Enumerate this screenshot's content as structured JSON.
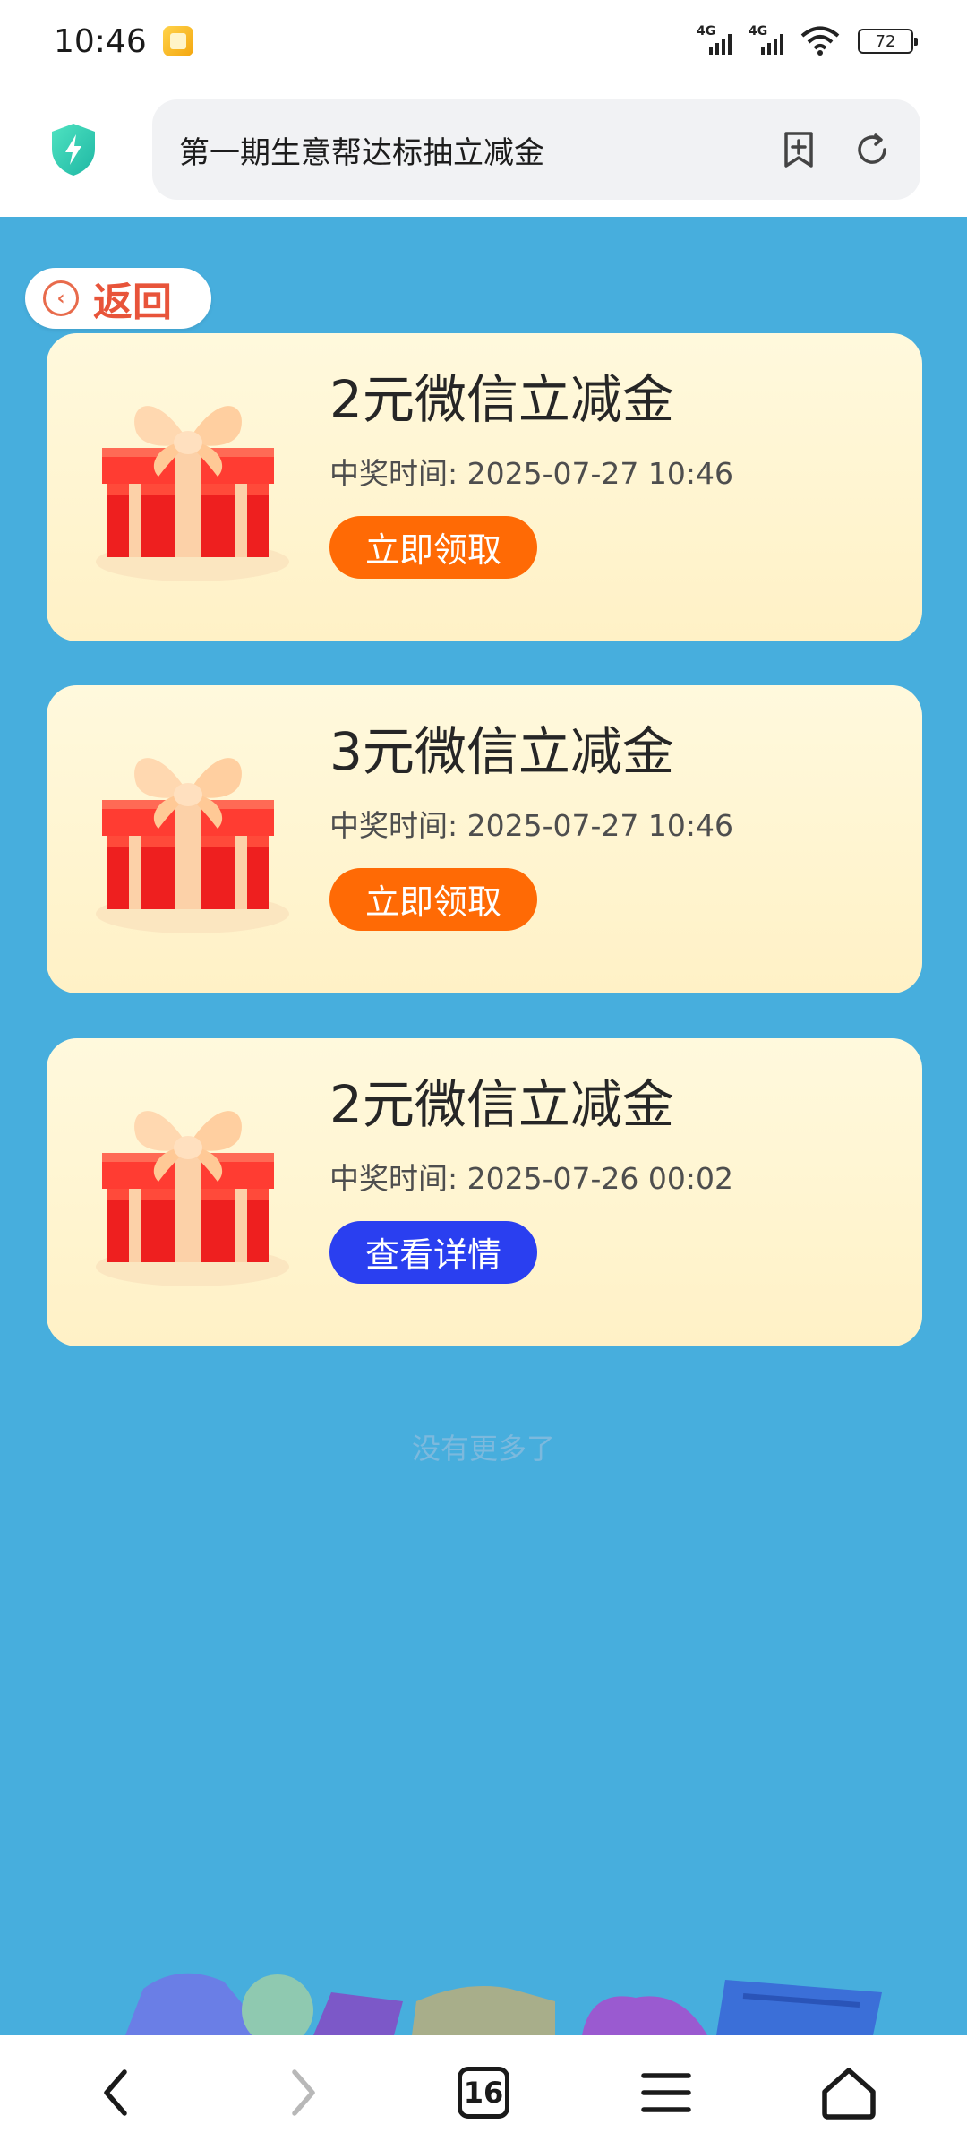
{
  "status_bar": {
    "time": "10:46",
    "network1": "4G",
    "network2": "4G",
    "battery": "72"
  },
  "browser": {
    "title": "第一期生意帮达标抽立减金",
    "icons": [
      "shield-icon",
      "bookmark-add-icon",
      "refresh-icon"
    ]
  },
  "back": {
    "label": "返回"
  },
  "prizes": [
    {
      "title": "2元微信立减金",
      "time_label": "中奖时间",
      "time": "2025-07-27 10:46",
      "action": "立即领取"
    },
    {
      "title": "3元微信立减金",
      "time_label": "中奖时间",
      "time": "2025-07-27 10:46",
      "action": "立即领取"
    },
    {
      "title": "2元微信立减金",
      "time_label": "中奖时间",
      "time": "2025-07-26 00:02",
      "action": "查看详情"
    }
  ],
  "footer": {
    "no_more": "没有更多了"
  },
  "nav": {
    "tab_count": "16"
  },
  "colors": {
    "background": "#47aedd",
    "claim_button": "#ff6a05",
    "details_button": "#2a3ff0",
    "back_text": "#e8543a"
  }
}
